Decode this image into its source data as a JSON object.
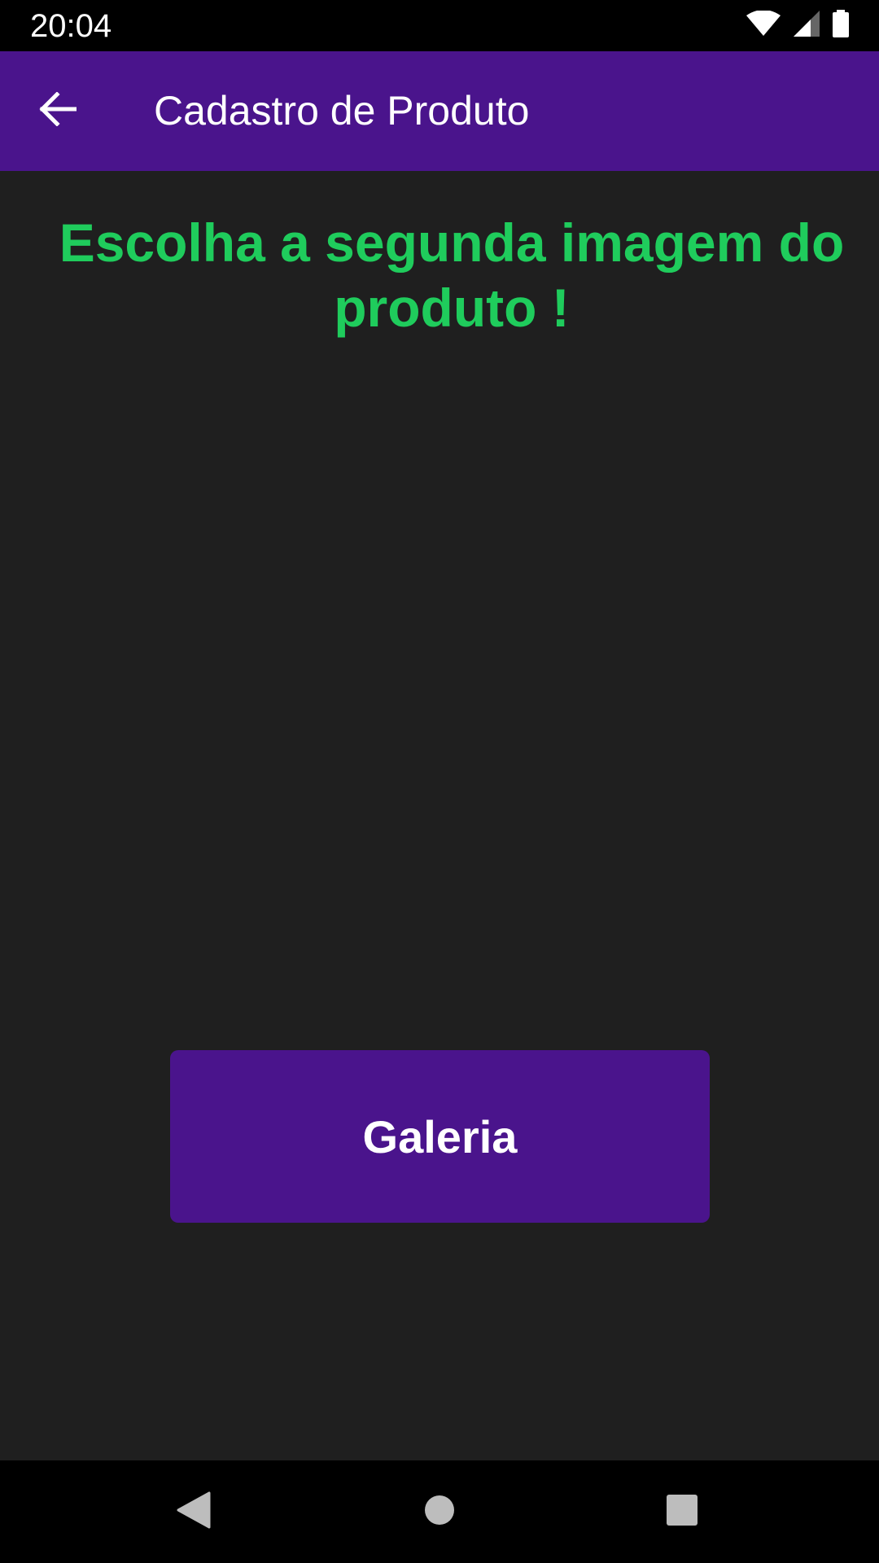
{
  "status_bar": {
    "time": "20:04",
    "icons": [
      "wifi-icon",
      "cell-signal-icon",
      "battery-icon"
    ]
  },
  "app_bar": {
    "title": "Cadastro de Produto",
    "back_icon": "arrow-back-icon",
    "background": "#4a148c"
  },
  "main": {
    "heading": "Escolha a segunda imagem do produto !",
    "heading_color": "#1fcc5c",
    "gallery_button_label": "Galeria"
  },
  "nav_bar": {
    "buttons": [
      "back-triangle-icon",
      "home-circle-icon",
      "recents-square-icon"
    ]
  }
}
